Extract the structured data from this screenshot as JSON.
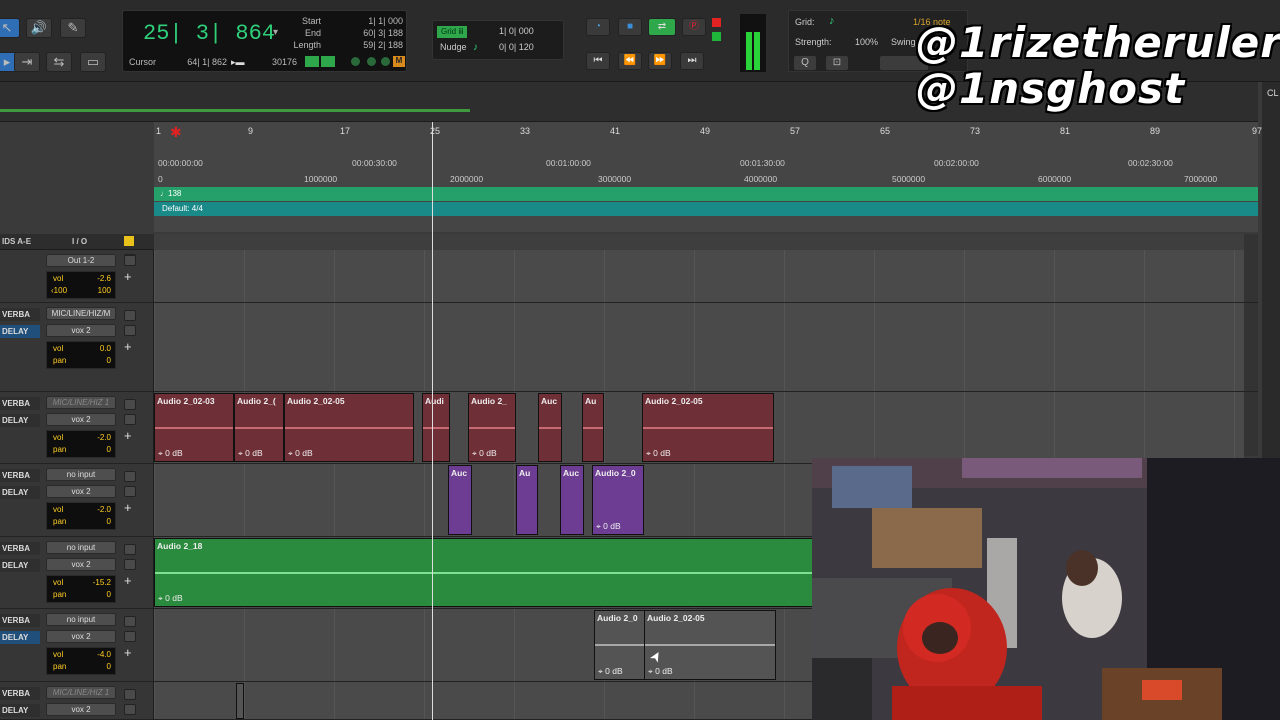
{
  "toolbar": {
    "tools": [
      "pointer-icon",
      "speaker-icon",
      "pencil-icon"
    ]
  },
  "counter": {
    "main": "25| 3| 864",
    "labels": {
      "start": "Start",
      "end": "End",
      "length": "Length",
      "cursor": "Cursor"
    },
    "start": "1| 1| 000",
    "end": "60| 3| 188",
    "length": "59| 2| 188",
    "cursor": "64| 1| 862",
    "samples": "30176"
  },
  "grid": {
    "grid_label": "Grid",
    "grid_value": "1| 0| 000",
    "nudge_label": "Nudge",
    "nudge_value": "0| 0| 120"
  },
  "gridpanel": {
    "grid_label": "Grid:",
    "grid_value": "1/16 note",
    "strength_label": "Strength:",
    "strength_value": "100%",
    "swing_label": "Swing"
  },
  "ruler": {
    "bars": [
      "1",
      "9",
      "17",
      "25",
      "33",
      "41",
      "49",
      "57",
      "65",
      "73",
      "81",
      "89",
      "97"
    ],
    "times": [
      "00:00:00:00",
      "00:00:30:00",
      "00:01:00:00",
      "00:01:30:00",
      "00:02:00:00",
      "00:02:30:00"
    ],
    "samples": [
      "0",
      "1000000",
      "2000000",
      "3000000",
      "4000000",
      "5000000",
      "6000000",
      "7000000"
    ],
    "tempo": "138",
    "meter": "Default: 4/4"
  },
  "mixheader": {
    "sends": "IDS A-E",
    "io": "I / O"
  },
  "tracks": [
    {
      "sends": [],
      "input": "",
      "output": "Out 1-2",
      "vol": "-2.6",
      "pan_l": "100",
      "pan_r": "100",
      "vol_lbl": "vol",
      "pan_lbl": ""
    },
    {
      "sends": [
        "VERBA",
        "DELAY"
      ],
      "input": "MIC/LINE/HIZ/M",
      "output": "vox 2",
      "vol": "0.0",
      "pan": "0",
      "vol_lbl": "vol",
      "pan_lbl": "pan"
    },
    {
      "sends": [
        "VERBA",
        "DELAY"
      ],
      "input": "MIC/LINE/HIZ 1",
      "output": "vox 2",
      "vol": "-2.0",
      "pan": "0",
      "vol_lbl": "vol",
      "pan_lbl": "pan"
    },
    {
      "sends": [
        "VERBA",
        "DELAY"
      ],
      "input": "no input",
      "output": "vox 2",
      "vol": "-2.0",
      "pan": "0",
      "vol_lbl": "vol",
      "pan_lbl": "pan"
    },
    {
      "sends": [
        "VERBA",
        "DELAY"
      ],
      "input": "no input",
      "output": "vox 2",
      "vol": "-15.2",
      "pan": "0",
      "vol_lbl": "vol",
      "pan_lbl": "pan"
    },
    {
      "sends": [
        "VERBA",
        "DELAY"
      ],
      "input": "no input",
      "output": "vox 2",
      "vol": "-4.0",
      "pan": "0",
      "vol_lbl": "vol",
      "pan_lbl": "pan"
    },
    {
      "sends": [
        "VERBA",
        "DELAY"
      ],
      "input": "MIC/LINE/HIZ 1",
      "output": "vox 2",
      "vol": "",
      "pan": "",
      "vol_lbl": "",
      "pan_lbl": ""
    }
  ],
  "clips": {
    "red": [
      {
        "name": "Audio 2_02-03",
        "gain": "0 dB"
      },
      {
        "name": "Audio 2_(",
        "gain": "0 dB"
      },
      {
        "name": "Audio 2_02-05",
        "gain": "0 dB"
      },
      {
        "name": "Audi",
        "gain": ""
      },
      {
        "name": "Audio 2_",
        "gain": "0 dB"
      },
      {
        "name": "Auc",
        "gain": ""
      },
      {
        "name": "Au",
        "gain": ""
      },
      {
        "name": "Audio 2_02-05",
        "gain": "0 dB"
      }
    ],
    "purple": [
      {
        "name": "Auc",
        "gain": ""
      },
      {
        "name": "Au",
        "gain": ""
      },
      {
        "name": "Auc",
        "gain": ""
      },
      {
        "name": "Audio 2_0",
        "gain": "0 dB"
      }
    ],
    "green": [
      {
        "name": "Audio 2_18",
        "gain": "0 dB"
      }
    ],
    "grey": [
      {
        "name": "Audio 2_0",
        "gain": "0 dB"
      },
      {
        "name": "Audio 2_02-05",
        "gain": "0 dB"
      }
    ]
  },
  "overlay": {
    "line1": "@1rizetheruler",
    "line2": "@1nsghost"
  },
  "rightpanel": {
    "label": "CL"
  }
}
